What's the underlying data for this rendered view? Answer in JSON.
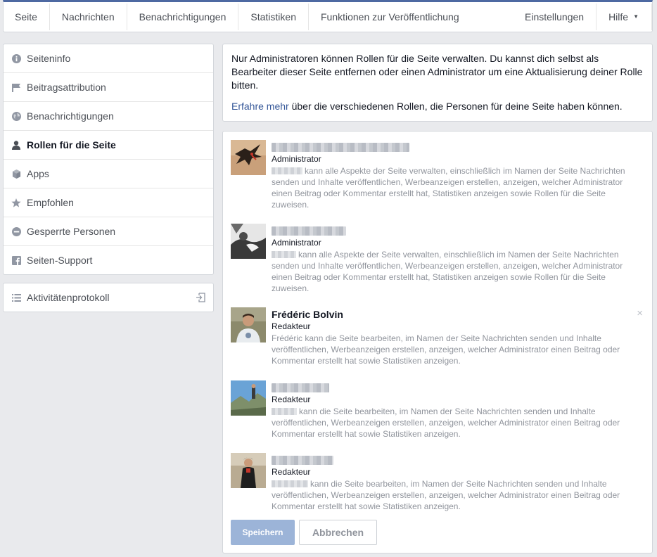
{
  "nav": {
    "tabs": [
      "Seite",
      "Nachrichten",
      "Benachrichtigungen",
      "Statistiken",
      "Funktionen zur Veröffentlichung"
    ],
    "settings": "Einstellungen",
    "help": "Hilfe",
    "caret": "▼"
  },
  "sidebar": {
    "items": [
      {
        "label": "Seiteninfo",
        "icon": "info-icon"
      },
      {
        "label": "Beitragsattribution",
        "icon": "flag-icon"
      },
      {
        "label": "Benachrichtigungen",
        "icon": "globe-icon"
      },
      {
        "label": "Rollen für die Seite",
        "icon": "person-icon",
        "active": true
      },
      {
        "label": "Apps",
        "icon": "cube-icon"
      },
      {
        "label": "Empfohlen",
        "icon": "star-icon"
      },
      {
        "label": "Gesperrte Personen",
        "icon": "block-icon"
      },
      {
        "label": "Seiten-Support",
        "icon": "facebook-icon"
      }
    ],
    "activity_log": "Aktivitätenprotokoll"
  },
  "notice": {
    "text": "Nur Administratoren können Rollen für die Seite verwalten. Du kannst dich selbst als Bearbeiter dieser Seite entfernen oder einen Administrator um eine Aktualisierung deiner Rolle bitten.",
    "link": "Erfahre mehr",
    "link_rest": " über die verschiedenen Rollen, die Personen für deine Seite haben können."
  },
  "people": [
    {
      "name": "",
      "role": "Administrator",
      "desc": "kann alle Aspekte der Seite verwalten, einschließlich im Namen der Seite Nachrichten senden und Inhalte veröffentlichen, Werbeanzeigen erstellen, anzeigen, welcher Administrator einen Beitrag oder Kommentar erstellt hat, Statistiken anzeigen sowie Rollen für die Seite zuweisen."
    },
    {
      "name": "",
      "role": "Administrator",
      "desc": "kann alle Aspekte der Seite verwalten, einschließlich im Namen der Seite Nachrichten senden und Inhalte veröffentlichen, Werbeanzeigen erstellen, anzeigen, welcher Administrator einen Beitrag oder Kommentar erstellt hat, Statistiken anzeigen sowie Rollen für die Seite zuweisen."
    },
    {
      "name": "Frédéric Bolvin",
      "role": "Redakteur",
      "desc": "Frédéric kann die Seite bearbeiten, im Namen der Seite Nachrichten senden und Inhalte veröffentlichen, Werbeanzeigen erstellen, anzeigen, welcher Administrator einen Beitrag oder Kommentar erstellt hat sowie Statistiken anzeigen.",
      "removable": true
    },
    {
      "name": "",
      "role": "Redakteur",
      "desc": "kann die Seite bearbeiten, im Namen der Seite Nachrichten senden und Inhalte veröffentlichen, Werbeanzeigen erstellen, anzeigen, welcher Administrator einen Beitrag oder Kommentar erstellt hat sowie Statistiken anzeigen."
    },
    {
      "name": "",
      "role": "Redakteur",
      "desc": "kann die Seite bearbeiten, im Namen der Seite Nachrichten senden und Inhalte veröffentlichen, Werbeanzeigen erstellen, anzeigen, welcher Administrator einen Beitrag oder Kommentar erstellt hat sowie Statistiken anzeigen."
    }
  ],
  "remove_symbol": "×",
  "buttons": {
    "save": "Speichern",
    "cancel": "Abbrechen"
  }
}
